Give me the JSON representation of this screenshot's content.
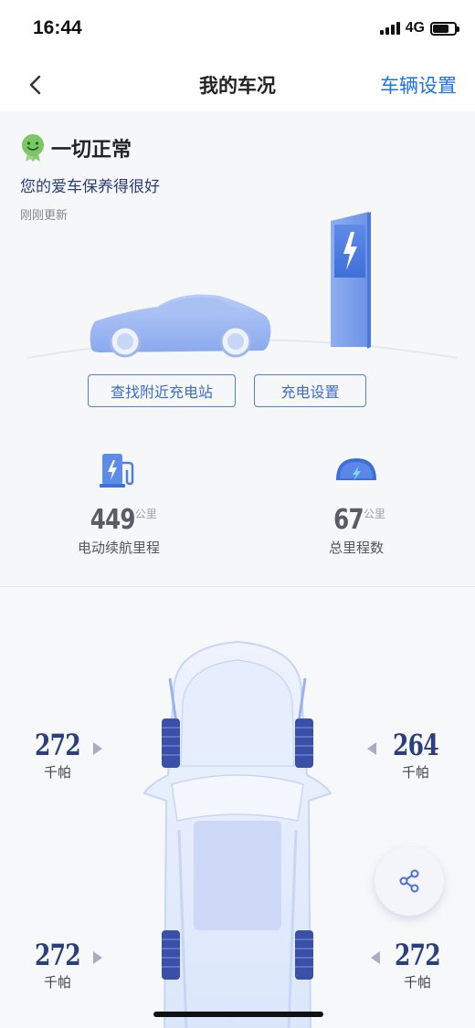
{
  "status_bar": {
    "time": "16:44",
    "network": "4G",
    "battery_level": 0.75
  },
  "nav": {
    "title": "我的车况",
    "action_label": "车辆设置"
  },
  "health": {
    "title": "一切正常",
    "subtitle": "您的爱车保养得很好",
    "updated": "刚刚更新"
  },
  "buttons": {
    "find_station": "查找附近充电站",
    "charge_settings": "充电设置"
  },
  "stats": {
    "range": {
      "value": "449",
      "unit": "公里",
      "label": "电动续航里程"
    },
    "odometer": {
      "value": "67",
      "unit": "公里",
      "label": "总里程数"
    }
  },
  "tires": {
    "front_left": {
      "value": "272",
      "unit": "千帕"
    },
    "front_right": {
      "value": "264",
      "unit": "千帕"
    },
    "rear_left": {
      "value": "272",
      "unit": "千帕"
    },
    "rear_right": {
      "value": "272",
      "unit": "千帕"
    }
  },
  "icons": {
    "back": "chevron-left-icon",
    "health": "smiley-badge-icon",
    "range": "charging-pile-icon",
    "odometer": "gauge-icon",
    "share": "share-icon"
  },
  "colors": {
    "accent": "#1a73e8",
    "tire_value": "#2b3f7e",
    "button_border": "#4f7fd9"
  }
}
